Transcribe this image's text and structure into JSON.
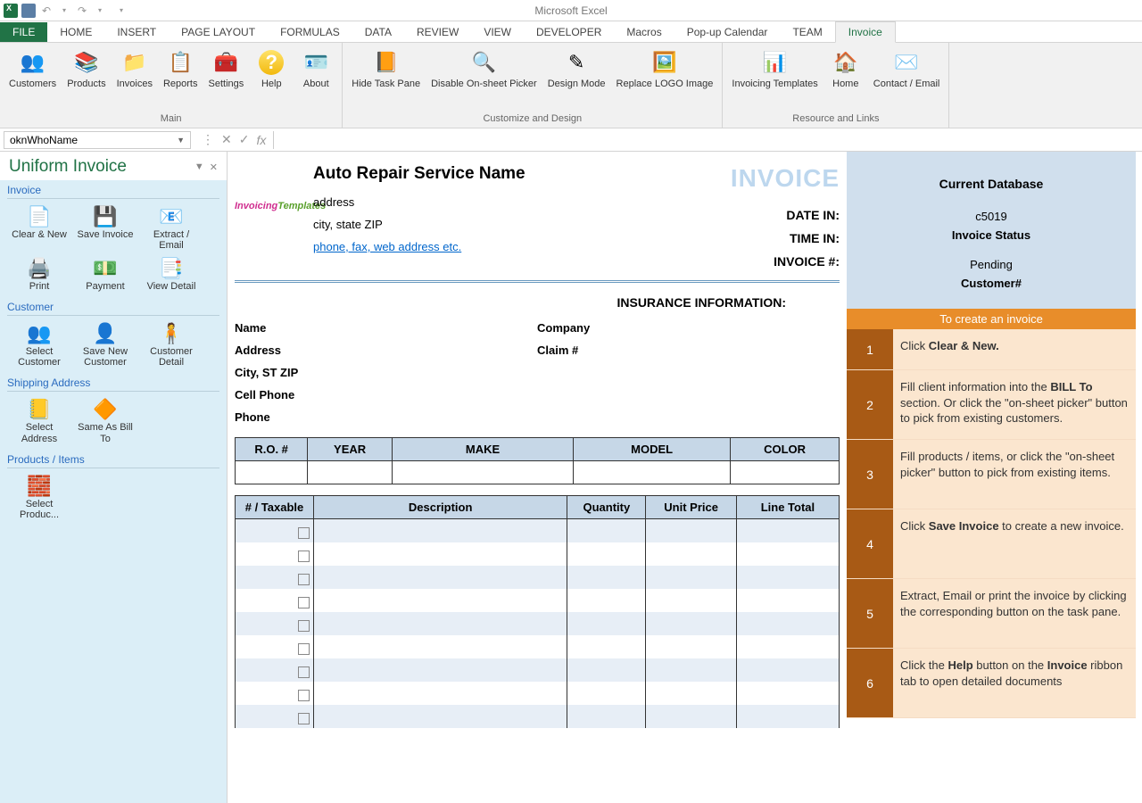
{
  "app": {
    "title": "Microsoft Excel"
  },
  "ribbon": {
    "tabs": [
      "FILE",
      "HOME",
      "INSERT",
      "PAGE LAYOUT",
      "FORMULAS",
      "DATA",
      "REVIEW",
      "VIEW",
      "DEVELOPER",
      "Macros",
      "Pop-up Calendar",
      "TEAM",
      "Invoice"
    ],
    "groups": {
      "main": {
        "label": "Main",
        "items": [
          "Customers",
          "Products",
          "Invoices",
          "Reports",
          "Settings",
          "Help",
          "About"
        ]
      },
      "cad": {
        "label": "Customize and Design",
        "items": [
          "Hide Task Pane",
          "Disable On-sheet Picker",
          "Design Mode",
          "Replace LOGO Image"
        ]
      },
      "res": {
        "label": "Resource and Links",
        "items": [
          "Invoicing Templates",
          "Home",
          "Contact / Email"
        ]
      }
    }
  },
  "formula": {
    "namebox": "oknWhoName"
  },
  "taskpane": {
    "title": "Uniform Invoice",
    "sections": {
      "invoice": {
        "title": "Invoice",
        "items": [
          "Clear & New",
          "Save Invoice",
          "Extract / Email",
          "Print",
          "Payment",
          "View Detail"
        ]
      },
      "customer": {
        "title": "Customer",
        "items": [
          "Select Customer",
          "Save New Customer",
          "Customer Detail"
        ]
      },
      "shipping": {
        "title": "Shipping Address",
        "items": [
          "Select Address",
          "Same As Bill To"
        ]
      },
      "products": {
        "title": "Products / Items",
        "items": [
          "Select Produc..."
        ]
      }
    }
  },
  "invoice": {
    "company_name": "Auto Repair Service Name",
    "address": "address",
    "citystate": "city, state ZIP",
    "contact": "phone, fax, web address etc.",
    "title": "INVOICE",
    "meta": {
      "datein": "DATE IN:",
      "timein": "TIME IN:",
      "invno": "INVOICE #:"
    },
    "insurance_header": "INSURANCE INFORMATION:",
    "cust_labels": {
      "name": "Name",
      "company": "Company",
      "address": "Address",
      "claim": "Claim #",
      "citystate": "City, ST ZIP",
      "cell": "Cell Phone",
      "phone": "Phone"
    },
    "vehicle_headers": [
      "R.O. #",
      "YEAR",
      "MAKE",
      "MODEL",
      "COLOR"
    ],
    "item_headers": [
      "# / Taxable",
      "Description",
      "Quantity",
      "Unit Price",
      "Line Total"
    ]
  },
  "side": {
    "db": {
      "header": "Current Database",
      "code": "c5019",
      "status_lbl": "Invoice Status",
      "status": "Pending",
      "cust": "Customer#"
    },
    "steps_header": "To create an invoice",
    "steps": [
      "Click <b>Clear & New.</b>",
      "Fill client information into the <b>BILL To</b> section. Or click the \"on-sheet picker\" button to pick from existing customers.",
      "Fill products / items, or click the \"on-sheet picker\" button to pick from existing items.",
      "Click <b>Save Invoice</b> to create a new invoice.",
      "Extract, Email or print the invoice by clicking the corresponding button on the task pane.",
      "Click the <b>Help</b> button on the <b>Invoice</b> ribbon tab to open detailed documents"
    ]
  }
}
